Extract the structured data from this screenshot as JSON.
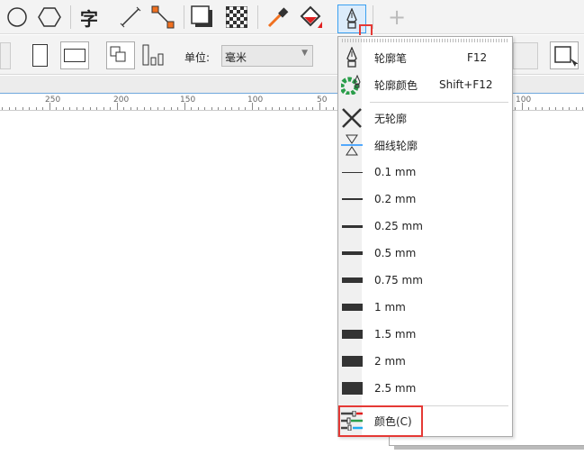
{
  "toolbar": {
    "unit_label": "单位:",
    "unit_value": "毫米"
  },
  "ruler": {
    "labels": [
      "250",
      "200",
      "150",
      "100",
      "50",
      "100"
    ]
  },
  "menu": {
    "items": [
      {
        "label": "轮廓笔",
        "shortcut": "F12",
        "icon": "pen-nib-icon"
      },
      {
        "label": "轮廓颜色",
        "shortcut": "Shift+F12",
        "icon": "outline-color-icon"
      },
      {
        "label": "无轮廓",
        "icon": "x-icon"
      },
      {
        "label": "细线轮廓",
        "icon": "hairline-icon"
      }
    ],
    "widths": [
      "0.1 mm",
      "0.2 mm",
      "0.25 mm",
      "0.5 mm",
      "0.75 mm",
      "1 mm",
      "1.5 mm",
      "2 mm",
      "2.5 mm"
    ],
    "color_label": "颜色(C)"
  },
  "colors": {
    "highlight": "#e53935",
    "accent": "#1e90ff"
  }
}
